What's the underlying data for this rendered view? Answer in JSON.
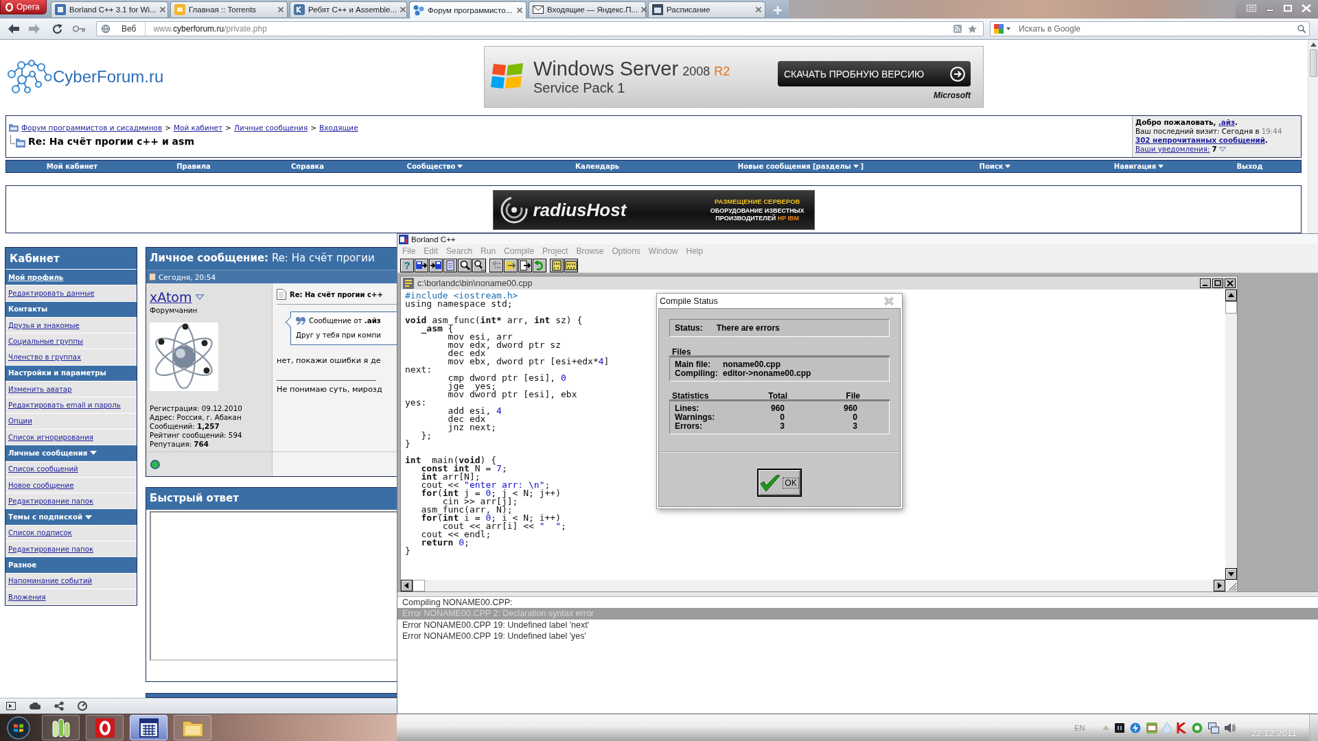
{
  "browser": {
    "menu_button": "Opera",
    "tabs": [
      {
        "kind": "app",
        "title": "Borland C++ 3.1 for Wi...",
        "selected": false
      },
      {
        "kind": "torrent",
        "title": "Главная :: Torrents",
        "selected": false
      },
      {
        "kind": "vk",
        "title": "Ребят C++ и Assemble...",
        "selected": false
      },
      {
        "kind": "forum",
        "title": "Форум программисто...",
        "selected": true
      },
      {
        "kind": "mail",
        "title": "Входящие — Яндекс.П...",
        "selected": false
      },
      {
        "kind": "calendar",
        "title": "Расписание",
        "selected": false
      }
    ],
    "address": {
      "scope": "Веб",
      "url": [
        {
          "text": "www.",
          "highlighted": false
        },
        {
          "text": "cyberforum.ru",
          "highlighted": true
        },
        {
          "text": "/private.php",
          "highlighted": false
        }
      ]
    },
    "search": {
      "placeholder": "Искать в Google"
    }
  },
  "page": {
    "logo": "CyberForum.ru",
    "top_banner": {
      "product": "Windows Server",
      "version": "2008",
      "edition": "R2",
      "pack": "Service Pack 1",
      "button": "СКАЧАТЬ ПРОБНУЮ ВЕРСИЮ",
      "vendor": "Microsoft"
    },
    "breadcrumbs": {
      "links": [
        {
          "text": "Форум программистов и сисадминов",
          "separator": ">"
        },
        {
          "text": "Мой кабинет",
          "separator": ">"
        },
        {
          "text": "Личные сообщения",
          "separator": ">"
        },
        {
          "text": "Входящие"
        }
      ],
      "title": "Re: На счёт прогии c++ и asm"
    },
    "welcome": {
      "greeting": "Добро пожаловать,",
      "user": ".айз",
      "user_end": ".",
      "last_visit": "Ваш последний визит: Сегодня в",
      "last_visit_time": "19:44",
      "unread": "302 непрочитанных сообщений",
      "unread_end": ".",
      "notifications": "Ваши уведомления:",
      "notification_count": "7"
    },
    "navbar": [
      {
        "label": "Мой кабинет",
        "dropdown": false
      },
      {
        "label": "Правила",
        "dropdown": false
      },
      {
        "label": "Справка",
        "dropdown": false
      },
      {
        "label": "Сообщество",
        "dropdown": true
      },
      {
        "label": "Календарь",
        "dropdown": false
      },
      {
        "label": "Новые сообщения [разделы",
        "dropdown": true,
        "suffix": "]"
      },
      {
        "label": "Поиск",
        "dropdown": true
      },
      {
        "label": "Навигация",
        "dropdown": true
      },
      {
        "label": "Выход",
        "dropdown": false
      }
    ],
    "ad_banner": {
      "brand": "radiusHost",
      "headline": "РАЗМЕЩЕНИЕ СЕРВЕРОВ",
      "lines": [
        "ОБОРУДОВАНИЕ ИЗВЕСТНЫХ",
        "ПРОИЗВОДИТЕЛЕЙ"
      ],
      "highlight": "HP IBM"
    },
    "sidebar": {
      "title": "Кабинет",
      "items": [
        {
          "label": "Мой профиль",
          "kind": "header_link",
          "dropdown": false
        },
        {
          "label": "Редактировать данные",
          "kind": "link",
          "dropdown": false
        },
        {
          "label": "Контакты",
          "kind": "header",
          "dropdown": false
        },
        {
          "label": "Друзья и знакомые",
          "kind": "link",
          "dropdown": false
        },
        {
          "label": "Социальные группы",
          "kind": "link",
          "dropdown": false
        },
        {
          "label": "Членство в группах",
          "kind": "link",
          "dropdown": false
        },
        {
          "label": "Настройки и параметры",
          "kind": "header",
          "dropdown": false
        },
        {
          "label": "Изменить аватар",
          "kind": "link",
          "dropdown": false
        },
        {
          "label": "Редактировать email и пароль",
          "kind": "link",
          "dropdown": false
        },
        {
          "label": "Опции",
          "kind": "link",
          "dropdown": false
        },
        {
          "label": "Список игнорирования",
          "kind": "link",
          "dropdown": false
        },
        {
          "label": "Личные сообщения",
          "kind": "header",
          "dropdown": true
        },
        {
          "label": "Список сообщений",
          "kind": "link",
          "dropdown": false
        },
        {
          "label": "Новое сообщение",
          "kind": "link",
          "dropdown": false
        },
        {
          "label": "Редактирование папок",
          "kind": "link",
          "dropdown": false
        },
        {
          "label": "Темы с подпиской",
          "kind": "header",
          "dropdown": true
        },
        {
          "label": "Список подписок",
          "kind": "link",
          "dropdown": false
        },
        {
          "label": "Редактирование папок",
          "kind": "link",
          "dropdown": false
        },
        {
          "label": "Разное",
          "kind": "header",
          "dropdown": false
        },
        {
          "label": "Напоминание событий",
          "kind": "link",
          "dropdown": false
        },
        {
          "label": "Вложения",
          "kind": "link",
          "dropdown": false
        }
      ]
    },
    "message": {
      "title": "**Личное сообщение:** Re: На счёт прогии",
      "date": "Сегодня, 20:54",
      "author": {
        "name": "xAtom",
        "rank": "Форумчанин",
        "stats": [
          "Регистрация: 09.12.2010",
          "Адрес: Россия, г. Абакан",
          "Сообщений: **1,257**",
          "Рейтинг сообщений: 594",
          "Репутация: **764**"
        ]
      },
      "subject": "Re: На счёт прогии c++",
      "quote": {
        "header": "Сообщение от **.айз**",
        "text": "Друг у тебя при компи"
      },
      "body": "нет, покажи ошибки я де",
      "signature": "Не понимаю суть, мирозд"
    },
    "quick_reply": {
      "title": "Быстрый ответ"
    }
  },
  "ide": {
    "title": "Borland C++",
    "menu": [
      {
        "label": "File",
        "disabled": true
      },
      {
        "label": "Edit",
        "disabled": true
      },
      {
        "label": "Search",
        "disabled": true
      },
      {
        "label": "Run",
        "disabled": true
      },
      {
        "label": "Compile",
        "disabled": true
      },
      {
        "label": "Project",
        "disabled": true
      },
      {
        "label": "Browse",
        "disabled": true
      },
      {
        "label": "Options",
        "disabled": true
      },
      {
        "label": "Window",
        "disabled": true
      },
      {
        "label": "Help",
        "disabled": true
      }
    ],
    "help_glyph": "?",
    "editor": {
      "path": "c:\\borlandc\\bin\\noname00.cpp",
      "code_blocks": [
        [
          [
            {
              "kind": "directive",
              "text": "#include <iostream.h>"
            }
          ],
          [
            {
              "kind": "plain",
              "text": "using namespace std;"
            }
          ]
        ],
        [
          [
            {
              "kind": "keyword",
              "text": "void"
            },
            {
              "kind": "plain",
              "text": " asm_func("
            },
            {
              "kind": "keyword",
              "text": "int*"
            },
            {
              "kind": "plain",
              "text": " arr, "
            },
            {
              "kind": "keyword",
              "text": "int"
            },
            {
              "kind": "plain",
              "text": " sz) {"
            }
          ],
          [
            {
              "kind": "keyword",
              "text": "   _asm"
            },
            {
              "kind": "plain",
              "text": " {"
            }
          ],
          [
            {
              "kind": "plain",
              "text": "        mov esi, arr"
            }
          ],
          [
            {
              "kind": "plain",
              "text": "        mov edx, dword ptr sz"
            }
          ],
          [
            {
              "kind": "plain",
              "text": "        dec edx"
            }
          ],
          [
            {
              "kind": "plain",
              "text": "        mov ebx, dword ptr [esi+edx*"
            },
            {
              "kind": "number",
              "text": "4"
            },
            {
              "kind": "plain",
              "text": "]"
            }
          ],
          [
            {
              "kind": "plain",
              "text": "next:"
            }
          ],
          [
            {
              "kind": "plain",
              "text": "        cmp dword ptr [esi], "
            },
            {
              "kind": "number",
              "text": "0"
            }
          ],
          [
            {
              "kind": "plain",
              "text": "        jge  yes;"
            }
          ],
          [
            {
              "kind": "plain",
              "text": "        mov dword ptr [esi], ebx"
            }
          ],
          [
            {
              "kind": "plain",
              "text": "yes:"
            }
          ],
          [
            {
              "kind": "plain",
              "text": "        add esi, "
            },
            {
              "kind": "number",
              "text": "4"
            }
          ],
          [
            {
              "kind": "plain",
              "text": "        dec edx"
            }
          ],
          [
            {
              "kind": "plain",
              "text": "        jnz next;"
            }
          ],
          [
            {
              "kind": "plain",
              "text": "   };"
            }
          ],
          [
            {
              "kind": "plain",
              "text": "}"
            }
          ]
        ],
        [
          [
            {
              "kind": "keyword",
              "text": "int"
            },
            {
              "kind": "plain",
              "text": "  main("
            },
            {
              "kind": "keyword",
              "text": "void"
            },
            {
              "kind": "plain",
              "text": ") {"
            }
          ],
          [
            {
              "kind": "keyword",
              "text": "   const int"
            },
            {
              "kind": "plain",
              "text": " N = "
            },
            {
              "kind": "number",
              "text": "7"
            },
            {
              "kind": "plain",
              "text": ";"
            }
          ],
          [
            {
              "kind": "keyword",
              "text": "   int"
            },
            {
              "kind": "plain",
              "text": " arr[N];"
            }
          ],
          [
            {
              "kind": "plain",
              "text": "   cout << "
            },
            {
              "kind": "string",
              "text": "\"enter arr: \\n\""
            },
            {
              "kind": "plain",
              "text": ";"
            }
          ],
          [
            {
              "kind": "keyword",
              "text": "   for"
            },
            {
              "kind": "plain",
              "text": "("
            },
            {
              "kind": "keyword",
              "text": "int"
            },
            {
              "kind": "plain",
              "text": " j = "
            },
            {
              "kind": "number",
              "text": "0"
            },
            {
              "kind": "plain",
              "text": "; j < N; j++)"
            }
          ],
          [
            {
              "kind": "plain",
              "text": "       cin >> arr[j];"
            }
          ],
          [
            {
              "kind": "plain",
              "text": "   asm_func(arr, N);"
            }
          ],
          [
            {
              "kind": "keyword",
              "text": "   for"
            },
            {
              "kind": "plain",
              "text": "("
            },
            {
              "kind": "keyword",
              "text": "int"
            },
            {
              "kind": "plain",
              "text": " i = "
            },
            {
              "kind": "number",
              "text": "0"
            },
            {
              "kind": "plain",
              "text": "; i < N; i++)"
            }
          ],
          [
            {
              "kind": "plain",
              "text": "       cout << arr[i] << "
            },
            {
              "kind": "string",
              "text": "\"  \""
            },
            {
              "kind": "plain",
              "text": ";"
            }
          ],
          [
            {
              "kind": "plain",
              "text": "   cout << endl;"
            }
          ],
          [
            {
              "kind": "keyword",
              "text": "   return"
            },
            {
              "kind": "number",
              "text": " 0"
            },
            {
              "kind": "plain",
              "text": ";"
            }
          ],
          [
            {
              "kind": "plain",
              "text": "}"
            }
          ]
        ]
      ]
    },
    "compile_status": {
      "title": "Compile Status",
      "status_label": "Status:",
      "status_value": "There are errors",
      "files_heading": "Files",
      "files": [
        {
          "label": "Main file:",
          "value": "noname00.cpp"
        },
        {
          "label": "Compiling:",
          "value": "editor->noname00.cpp"
        }
      ],
      "stats_headings": [
        "Statistics",
        "Total",
        "File"
      ],
      "stats": [
        {
          "label": "Lines:",
          "total": "960",
          "file": "960"
        },
        {
          "label": "Warnings:",
          "total": "0",
          "file": "0"
        },
        {
          "label": "Errors:",
          "total": "3",
          "file": "3"
        }
      ],
      "ok_label": "OK"
    },
    "messages": [
      {
        "text": "Compiling NONAME00.CPP:",
        "selected": false
      },
      {
        "text": "Error NONAME00.CPP 2: Declaration syntax error",
        "selected": true
      },
      {
        "text": "Error NONAME00.CPP 19: Undefined label 'next'",
        "selected": false
      },
      {
        "text": "Error NONAME00.CPP 19: Undefined label 'yes'",
        "selected": false
      }
    ]
  },
  "taskbar": {
    "apps": [
      {
        "kind": "lab",
        "selected": false
      },
      {
        "kind": "opera",
        "selected": false
      },
      {
        "kind": "ide",
        "selected": true
      },
      {
        "kind": "folder",
        "selected": false
      }
    ],
    "language": "EN",
    "date": "22.12.2011"
  }
}
